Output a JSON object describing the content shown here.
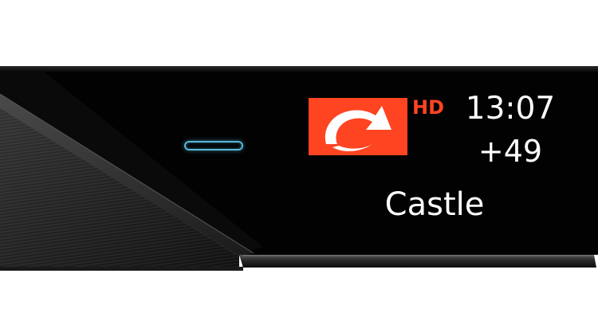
{
  "display": {
    "channel_logo": "kabel-eins-logo",
    "hd_label": "HD",
    "time": "13:07",
    "channel_number": "+49",
    "program_title": "Castle"
  },
  "colors": {
    "logo_red": "#ff4422",
    "display_background": "#000000",
    "text": "#ffffff",
    "led": "#57b8d8",
    "body_dark": "#1c1c1c",
    "page_background": "#ffffff"
  }
}
